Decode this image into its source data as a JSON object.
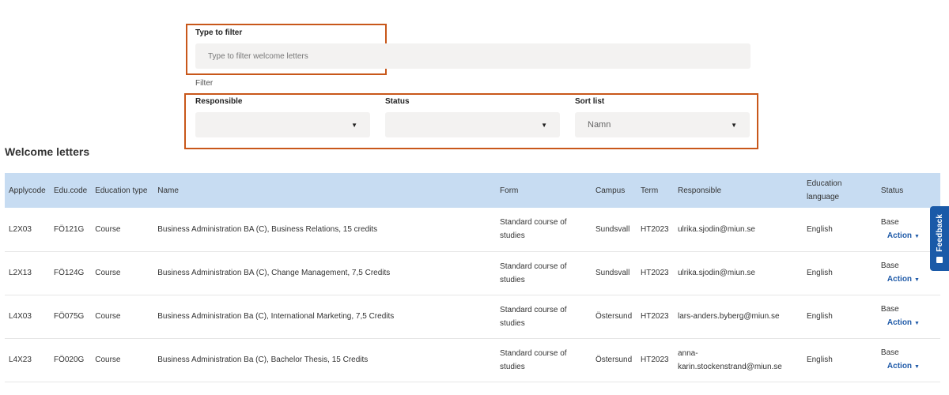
{
  "filter": {
    "label": "Type to filter",
    "placeholder": "Type to filter welcome letters",
    "section_label": "Filter"
  },
  "selects": {
    "responsible": {
      "label": "Responsible",
      "value": ""
    },
    "status": {
      "label": "Status",
      "value": ""
    },
    "sort": {
      "label": "Sort list",
      "value": "Namn"
    }
  },
  "section_title": "Welcome letters",
  "table": {
    "headers": [
      "Applycode",
      "Edu.code",
      "Education type",
      "Name",
      "Form",
      "Campus",
      "Term",
      "Responsible",
      "Education language",
      "Status"
    ],
    "rows": [
      {
        "applycode": "L2X03",
        "educode": "FÖ121G",
        "type": "Course",
        "name": "Business Administration BA (C), Business Relations, 15 credits",
        "form": "Standard course of studies",
        "campus": "Sundsvall",
        "term": "HT2023",
        "responsible": "ulrika.sjodin@miun.se",
        "language": "English",
        "status": "Base",
        "action": "Action"
      },
      {
        "applycode": "L2X13",
        "educode": "FÖ124G",
        "type": "Course",
        "name": "Business Administration BA (C), Change Management, 7,5 Credits",
        "form": "Standard course of studies",
        "campus": "Sundsvall",
        "term": "HT2023",
        "responsible": "ulrika.sjodin@miun.se",
        "language": "English",
        "status": "Base",
        "action": "Action"
      },
      {
        "applycode": "L4X03",
        "educode": "FÖ075G",
        "type": "Course",
        "name": "Business Administration Ba (C), International Marketing, 7,5 Credits",
        "form": "Standard course of studies",
        "campus": "Östersund",
        "term": "HT2023",
        "responsible": "lars-anders.byberg@miun.se",
        "language": "English",
        "status": "Base",
        "action": "Action"
      },
      {
        "applycode": "L4X23",
        "educode": "FÖ020G",
        "type": "Course",
        "name": "Business Administration Ba (C), Bachelor Thesis, 15 Credits",
        "form": "Standard course of studies",
        "campus": "Östersund",
        "term": "HT2023",
        "responsible": "anna-karin.stockenstrand@miun.se",
        "language": "English",
        "status": "Base",
        "action": "Action"
      }
    ]
  },
  "feedback": {
    "label": "Feedback"
  },
  "colors": {
    "highlight": "#c8571a",
    "header_bg": "#c7dcf2",
    "accent": "#1f5aa8"
  }
}
